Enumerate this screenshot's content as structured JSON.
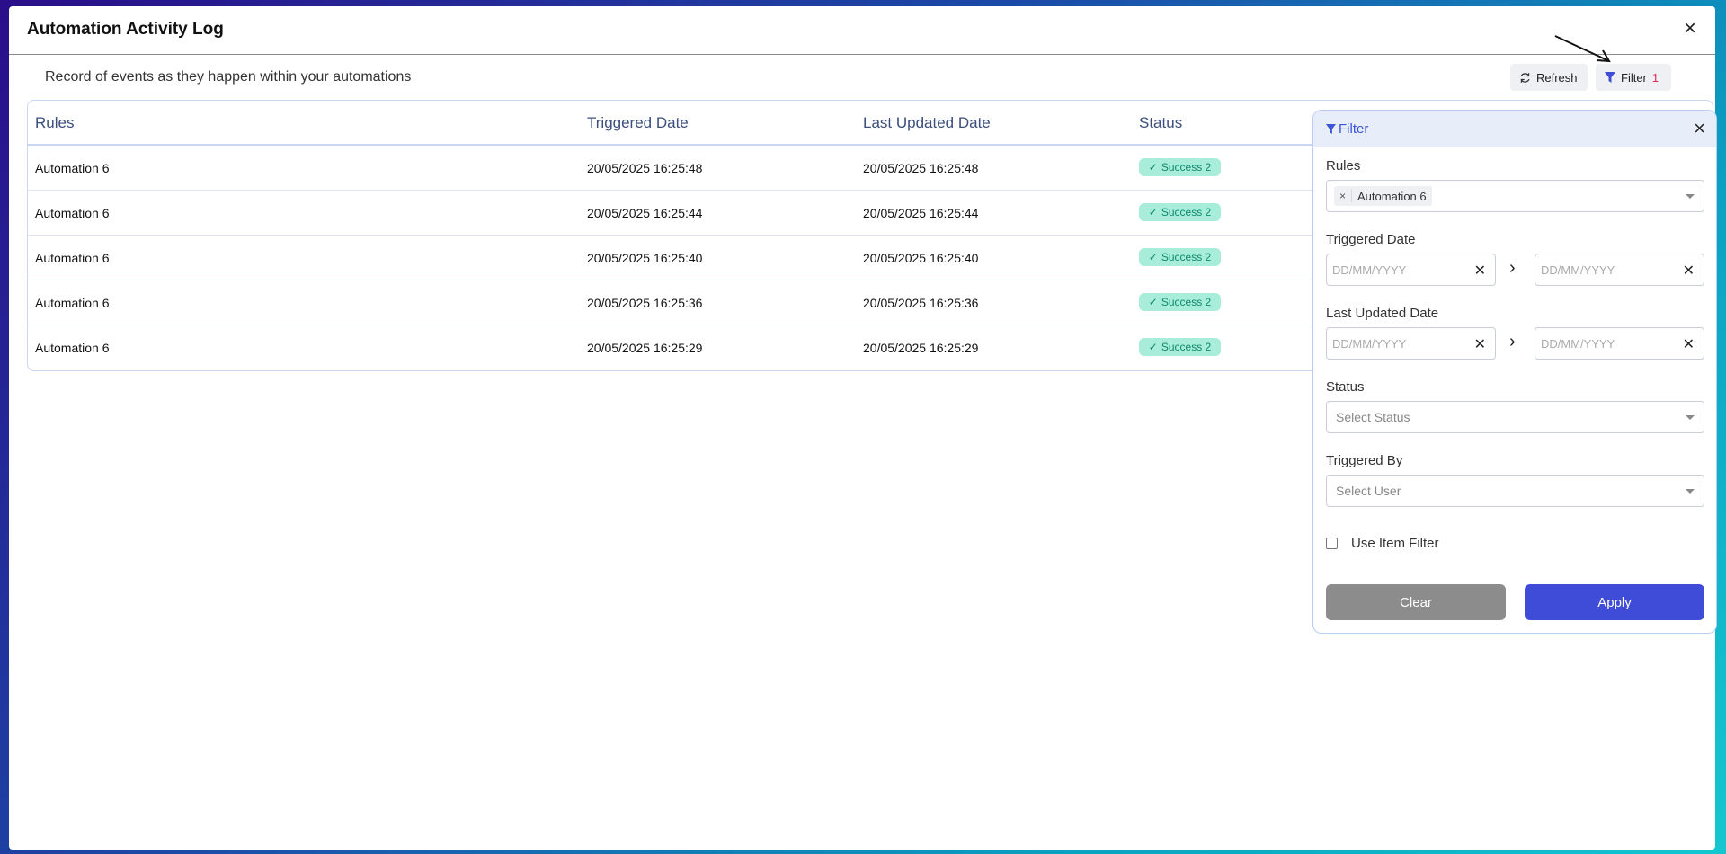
{
  "modal": {
    "title": "Automation Activity Log",
    "subtitle": "Record of events as they happen within your automations",
    "close_icon": "×"
  },
  "toolbar": {
    "refresh_label": "Refresh",
    "filter_label": "Filter",
    "filter_count": "1"
  },
  "table": {
    "headers": [
      "Rules",
      "Triggered Date",
      "Last Updated Date",
      "Status"
    ],
    "rows": [
      {
        "rule": "Automation 6",
        "triggered": "20/05/2025 16:25:48",
        "updated": "20/05/2025 16:25:48",
        "status": "Success 2"
      },
      {
        "rule": "Automation 6",
        "triggered": "20/05/2025 16:25:44",
        "updated": "20/05/2025 16:25:44",
        "status": "Success 2"
      },
      {
        "rule": "Automation 6",
        "triggered": "20/05/2025 16:25:40",
        "updated": "20/05/2025 16:25:40",
        "status": "Success 2"
      },
      {
        "rule": "Automation 6",
        "triggered": "20/05/2025 16:25:36",
        "updated": "20/05/2025 16:25:36",
        "status": "Success 2"
      },
      {
        "rule": "Automation 6",
        "triggered": "20/05/2025 16:25:29",
        "updated": "20/05/2025 16:25:29",
        "status": "Success 2"
      }
    ]
  },
  "filter_panel": {
    "title": "Filter",
    "rules_label": "Rules",
    "rules_selected": "Automation 6",
    "triggered_label": "Triggered Date",
    "updated_label": "Last Updated Date",
    "date_placeholder": "DD/MM/YYYY",
    "status_label": "Status",
    "status_placeholder": "Select Status",
    "triggered_by_label": "Triggered By",
    "triggered_by_placeholder": "Select User",
    "use_item_filter_label": "Use Item Filter",
    "clear_label": "Clear",
    "apply_label": "Apply"
  },
  "colors": {
    "accent": "#3f4cd8",
    "success_bg": "#a8ecda",
    "success_text": "#0e8a6b",
    "filter_count": "#e0285b"
  }
}
